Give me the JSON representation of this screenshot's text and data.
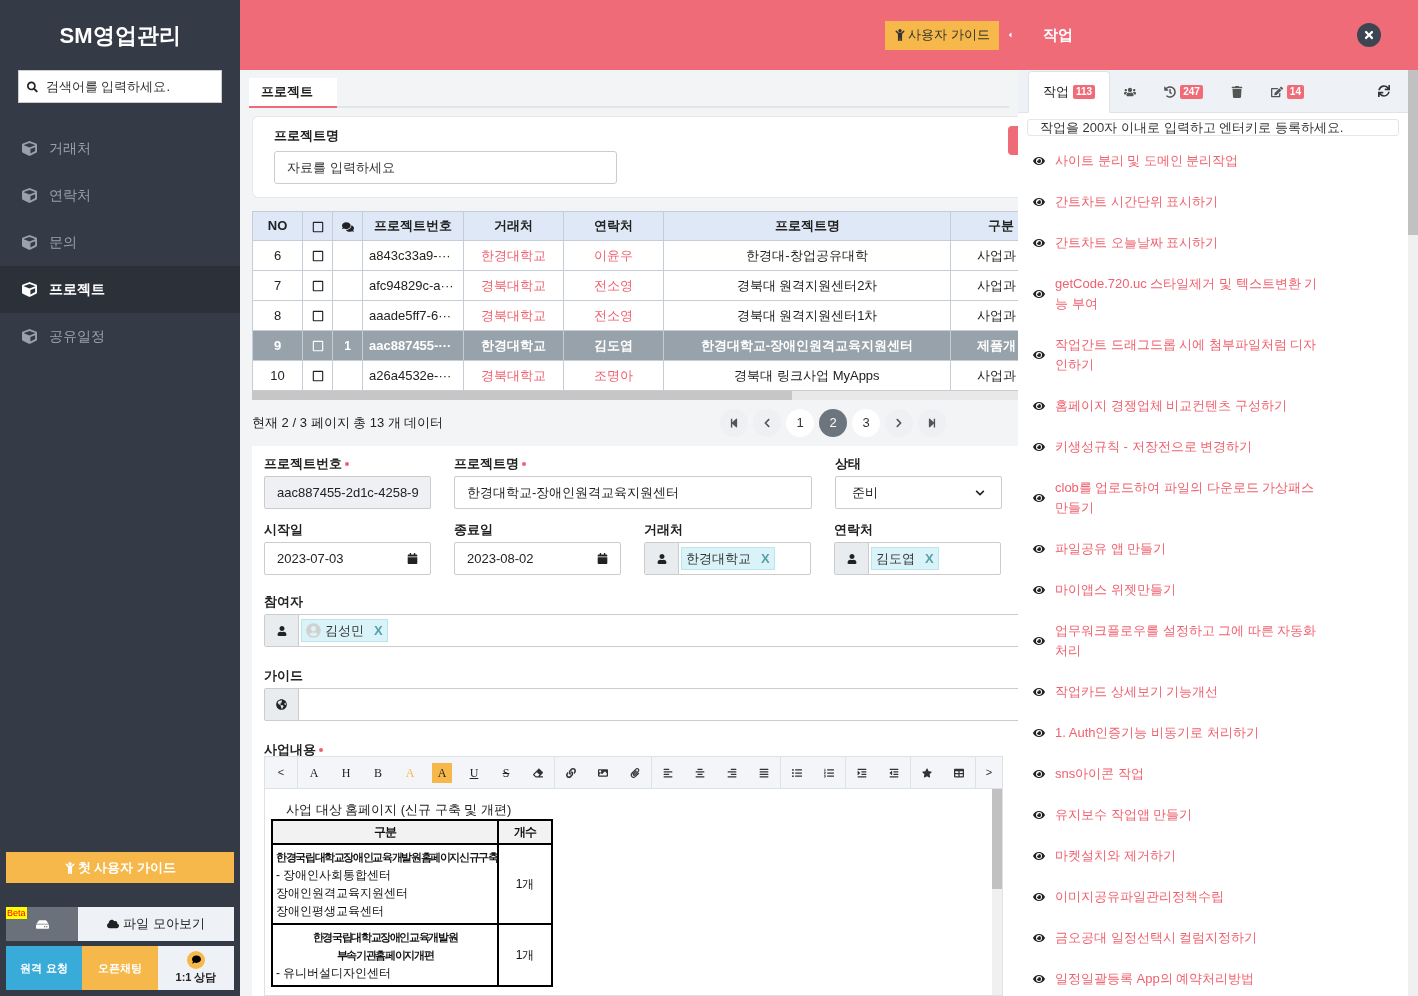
{
  "sidebar": {
    "title": "SM영업관리",
    "search": {
      "placeholder": "검색어를 입력하세요."
    },
    "items": [
      {
        "label": "거래처",
        "selected": false
      },
      {
        "label": "연락처",
        "selected": false
      },
      {
        "label": "문의",
        "selected": false
      },
      {
        "label": "프로젝트",
        "selected": true
      },
      {
        "label": "공유일정",
        "selected": false
      }
    ],
    "guide_button": "첫 사용자 가이드",
    "beta_badge": "Beta",
    "files_button": "파일 모아보기",
    "bottom_buttons": [
      {
        "kind": "remote",
        "label": "원격 요청"
      },
      {
        "kind": "chat",
        "label": "오픈채팅"
      },
      {
        "kind": "consult",
        "label": "1:1 상담"
      }
    ]
  },
  "header": {
    "guide_button": "사용자 가이드",
    "title": "작업"
  },
  "main": {
    "tabs": [
      {
        "label": "프로젝트",
        "selected": true
      }
    ],
    "filter": {
      "label": "프로젝트명",
      "placeholder": "자료를 입력하세요"
    },
    "table": {
      "columns": [
        "NO",
        "프로젝트번호",
        "거래처",
        "연락처",
        "프로젝트명",
        "구분"
      ],
      "rows": [
        {
          "no": "6",
          "checked": false,
          "id": "a843c33a9-···",
          "client": "한경대학교",
          "contact": "이윤우",
          "name": "한경대-창업공유대학",
          "category": "사업과",
          "selected": false
        },
        {
          "no": "7",
          "checked": false,
          "id": "afc94829c-a···",
          "client": "경북대학교",
          "contact": "전소영",
          "name": "경북대 원격지원센터2차",
          "category": "사업과",
          "selected": false
        },
        {
          "no": "8",
          "checked": false,
          "id": "aaade5ff7-6···",
          "client": "경북대학교",
          "contact": "전소영",
          "name": "경북대 원격지원센터1차",
          "category": "사업과",
          "selected": false
        },
        {
          "no": "9",
          "checked": false,
          "comments": "1",
          "id": "aac887455-···",
          "client": "한경대학교",
          "contact": "김도엽",
          "name": "한경대학교-장애인원격교육지원센터",
          "category": "제품개",
          "selected": true
        },
        {
          "no": "10",
          "checked": false,
          "id": "a26a4532e-···",
          "client": "경북대학교",
          "contact": "조명아",
          "name": "경북대 링크사업 MyApps",
          "category": "사업과",
          "selected": false
        }
      ]
    },
    "pagination": {
      "summary": "현재 2 / 3 페이지 총 13 개 데이터",
      "pages": [
        {
          "label": "1",
          "selected": false
        },
        {
          "label": "2",
          "selected": true
        },
        {
          "label": "3",
          "selected": false
        }
      ]
    },
    "form": {
      "project_no": {
        "label": "프로젝트번호",
        "required": true,
        "value": "aac887455-2d1c-4258-9"
      },
      "project_name": {
        "label": "프로젝트명",
        "required": true,
        "value": "한경대학교-장애인원격교육지원센터"
      },
      "status": {
        "label": "상태",
        "value": "준비"
      },
      "start": {
        "label": "시작일",
        "value": "2023-07-03"
      },
      "end": {
        "label": "종료일",
        "value": "2023-08-02"
      },
      "client": {
        "label": "거래처",
        "tag": "한경대학교",
        "remove": "X"
      },
      "contact": {
        "label": "연락처",
        "tag": "김도엽",
        "remove": "X"
      },
      "participants": {
        "label": "참여자",
        "tag": "김성민",
        "remove": "X"
      },
      "guide": {
        "label": "가이드"
      },
      "content": {
        "label": "사업내용",
        "required": true,
        "toolbar_prev": "<",
        "toolbar_next": ">",
        "toolbar_text": [
          {
            "kind": "plain",
            "label": "A"
          },
          {
            "kind": "plain",
            "label": "H"
          },
          {
            "kind": "plain",
            "label": "B"
          },
          {
            "kind": "color",
            "label": "A"
          },
          {
            "kind": "highlight",
            "label": "A"
          },
          {
            "kind": "underline",
            "label": "U"
          },
          {
            "kind": "strike",
            "label": "S"
          }
        ],
        "heading": "사업 대상 홈페이지 (신규 구축 및 개편)",
        "table_head": [
          "구분",
          "개수"
        ],
        "table_rows": [
          {
            "title": [
              "한경국립대학교장애인교육개발원홈페이지신규구축"
            ],
            "lines": [
              "- 장애인사회통합센터",
              "장애인원격교육지원센터",
              "장애인평생교육센터"
            ],
            "count": "1개"
          },
          {
            "title": [
              "한경국립대학교장애인교육개발원",
              "부속기관홈페이지개편"
            ],
            "lines": [
              "- 유니버설디자인센터"
            ],
            "count": "1개"
          }
        ]
      }
    }
  },
  "tasks": {
    "tabs": [
      {
        "kind": "tasks",
        "label": "작업",
        "badge": "113",
        "selected": true
      },
      {
        "kind": "members",
        "selected": false
      },
      {
        "kind": "history",
        "badge": "247",
        "selected": false
      },
      {
        "kind": "trash",
        "selected": false
      },
      {
        "kind": "notes",
        "badge": "14",
        "selected": false
      }
    ],
    "input": {
      "placeholder": "작업을 200자 이내로 입력하고 엔터키로 등록하세요."
    },
    "items": [
      "사이트 분리 및 도메인 분리작업",
      "간트차트 시간단위 표시하기",
      "간트차트 오늘날짜 표시하기",
      "getCode.720.uc 스타일제거 및 텍스트변환 기능 부여",
      "작업간트 드래그드롭 시에 첨부파일처럼 디자인하기",
      "홈페이지 경쟁업체 비교컨텐츠 구성하기",
      "키생성규칙 - 저장전으로 변경하기",
      "clob를 업로드하여 파일의 다운로드 가상패스 만들기",
      "파일공유 앱 만들기",
      "마이앱스 위젯만들기",
      "업무워크플로우를 설정하고 그에 따른 자동화처리",
      "작업카드 상세보기 기능개선",
      "1. Auth인증기능 비동기로 처리하기",
      "sns아이콘 작업",
      "유지보수 작업앱 만들기",
      "마켓설치와 제거하기",
      "이미지공유파일관리정책수립",
      "금오공대 일정선택시 컬럼지정하기",
      "일정일괄등록 App의 예약처리방법"
    ]
  }
}
